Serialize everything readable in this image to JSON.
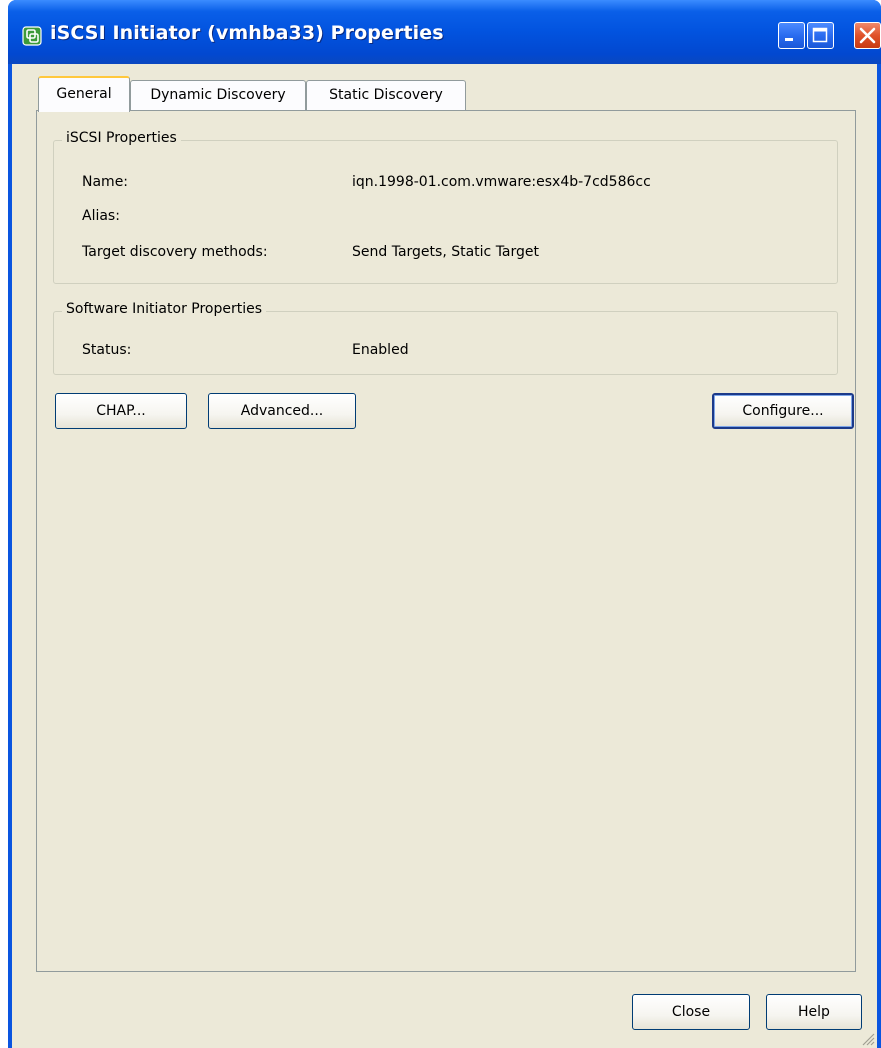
{
  "window": {
    "title": "iSCSI Initiator (vmhba33) Properties"
  },
  "tabs": [
    {
      "label": "General",
      "active": true
    },
    {
      "label": "Dynamic Discovery",
      "active": false
    },
    {
      "label": "Static Discovery",
      "active": false
    }
  ],
  "iscsi_properties": {
    "legend": "iSCSI Properties",
    "name_label": "Name:",
    "name_value": "iqn.1998-01.com.vmware:esx4b-7cd586cc",
    "alias_label": "Alias:",
    "alias_value": "",
    "discovery_label": "Target discovery methods:",
    "discovery_value": "Send Targets, Static Target"
  },
  "software_initiator": {
    "legend": "Software Initiator Properties",
    "status_label": "Status:",
    "status_value": "Enabled"
  },
  "buttons": {
    "chap": "CHAP...",
    "advanced": "Advanced...",
    "configure": "Configure...",
    "close": "Close",
    "help": "Help"
  },
  "icons": {
    "title": "vmware-app-icon",
    "minimize": "minimize-icon",
    "maximize": "maximize-icon",
    "close": "close-icon"
  },
  "colors": {
    "titlebar": "#0253df",
    "client_bg": "#ece9d8",
    "close_button": "#e0522a"
  }
}
